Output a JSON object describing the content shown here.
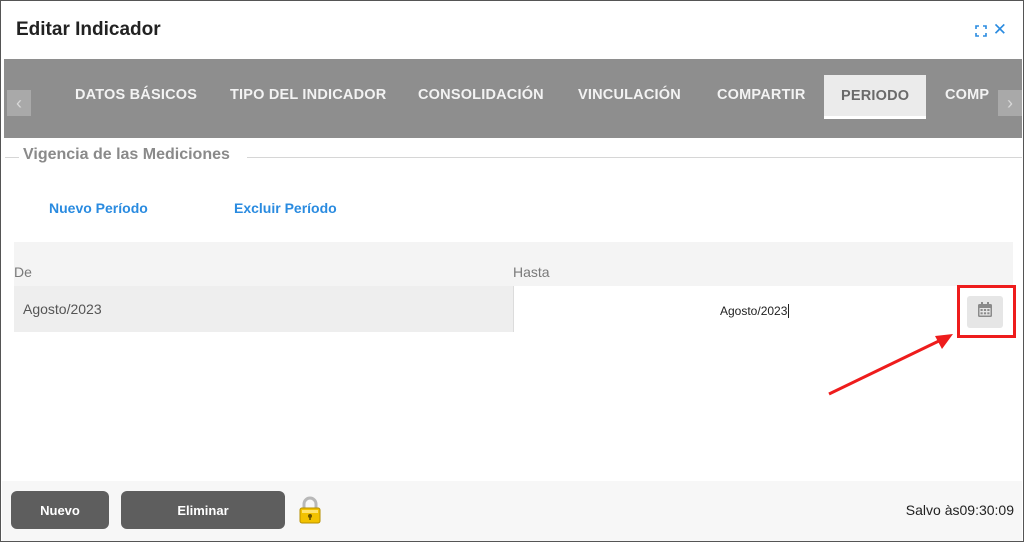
{
  "dialog": {
    "title": "Editar Indicador",
    "expand_icon": "expand-icon",
    "close_glyph": "✕",
    "close_icon": "close-icon"
  },
  "tabs": {
    "prev_glyph": "‹",
    "next_glyph": "›",
    "items": [
      {
        "label": "DATOS BÁSICOS"
      },
      {
        "label": "TIPO DEL INDICADOR"
      },
      {
        "label": "CONSOLIDACIÓN"
      },
      {
        "label": "VINCULACIÓN"
      },
      {
        "label": "COMPARTIR"
      },
      {
        "label": "PERIODO",
        "active": true
      },
      {
        "label": "COMP"
      }
    ]
  },
  "section": {
    "legend": "Vigencia de las Mediciones",
    "new_period": "Nuevo Período",
    "exclude_period": "Excluir Período"
  },
  "table": {
    "columns": [
      "De",
      "Hasta"
    ],
    "rows": [
      {
        "de": "Agosto/2023",
        "hasta": "Agosto/2023"
      }
    ],
    "calendar_icon": "calendar-icon"
  },
  "annotation": {
    "color": "#ee1c1c"
  },
  "footer": {
    "new_label": "Nuevo",
    "delete_label": "Eliminar",
    "lock_icon": "lock-icon",
    "saved_text": "Salvo às09:30:09"
  },
  "colors": {
    "accent": "#2a8be0",
    "tabbar": "#8e8e8e",
    "button": "#5e5e5e"
  }
}
